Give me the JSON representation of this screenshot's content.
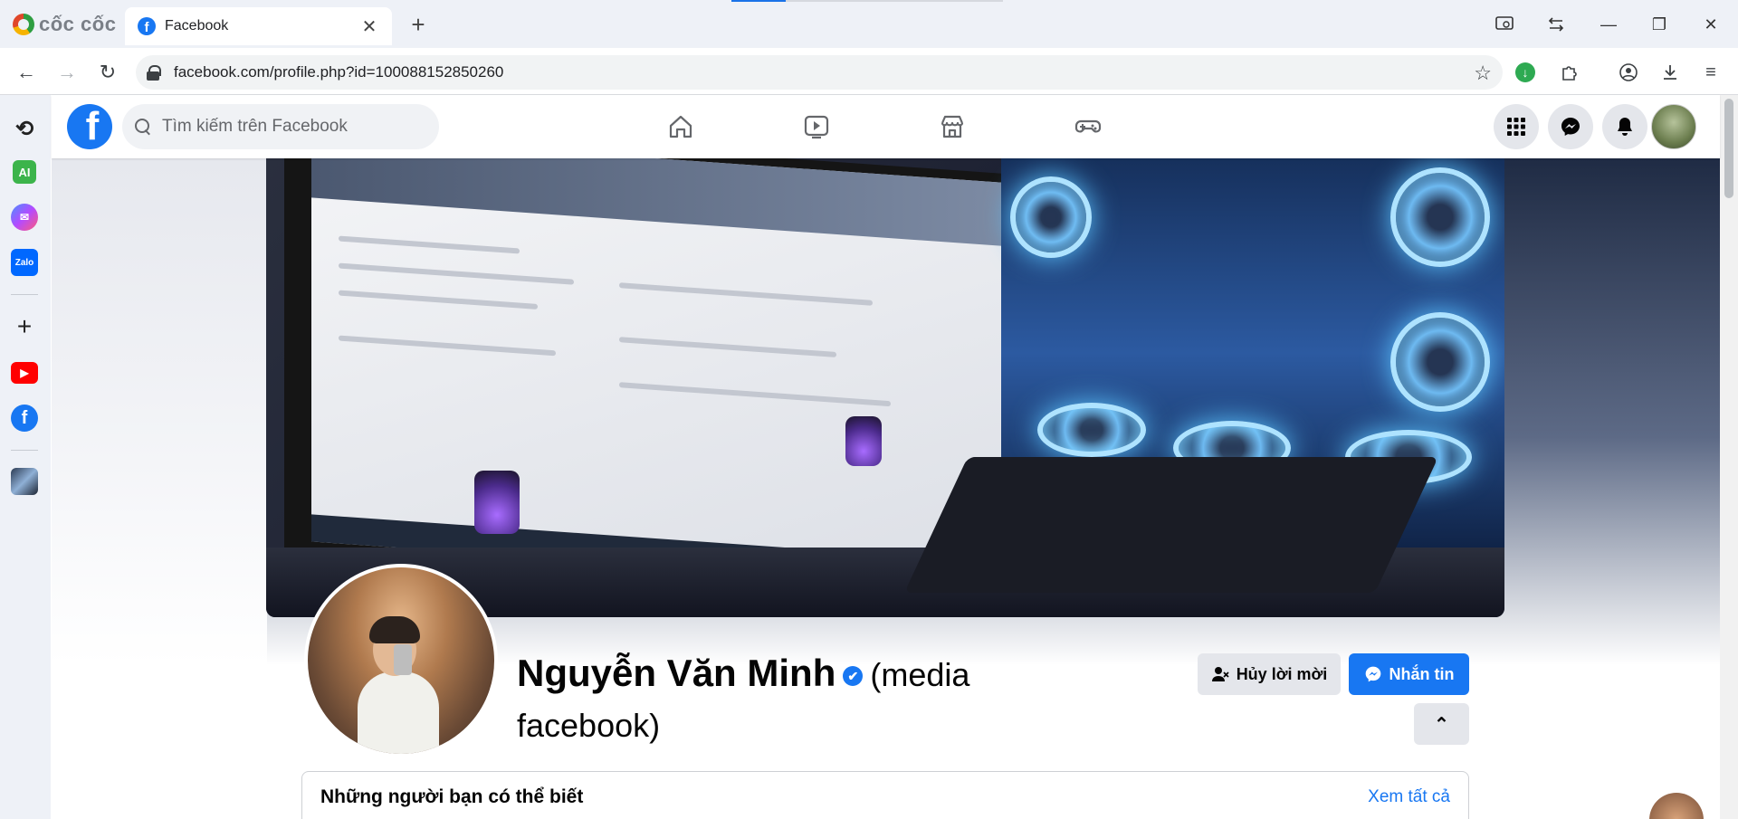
{
  "browser": {
    "brand": "cốc cốc",
    "tab": {
      "title": "Facebook",
      "favicon": "f"
    },
    "url": "facebook.com/profile.php?id=100088152850260"
  },
  "sidebar": {
    "items": [
      {
        "name": "history-icon",
        "label": "⟲"
      },
      {
        "name": "ai-icon",
        "label": "AI"
      },
      {
        "name": "messenger-icon",
        "label": "✉"
      },
      {
        "name": "zalo-icon",
        "label": "Zalo"
      },
      {
        "name": "add-icon",
        "label": "+"
      },
      {
        "name": "youtube-icon",
        "label": "▶"
      },
      {
        "name": "facebook-icon",
        "label": "f"
      }
    ]
  },
  "facebook": {
    "logo": "f",
    "search": {
      "placeholder": "Tìm kiếm trên Facebook",
      "value": ""
    },
    "profile": {
      "name": "Nguyễn Văn Minh",
      "verified_mark": "✔",
      "suffix": "(media facebook)",
      "cancel_request_label": "Hủy lời mời",
      "message_label": "Nhắn tin",
      "collapse_label": "⌃"
    },
    "pymk": {
      "title": "Những người bạn có thể biết",
      "see_all": "Xem tất cả"
    }
  },
  "colors": {
    "facebook_blue": "#1877f2",
    "chrome_bg": "#eef1f7",
    "button_gray": "#e4e6eb"
  }
}
